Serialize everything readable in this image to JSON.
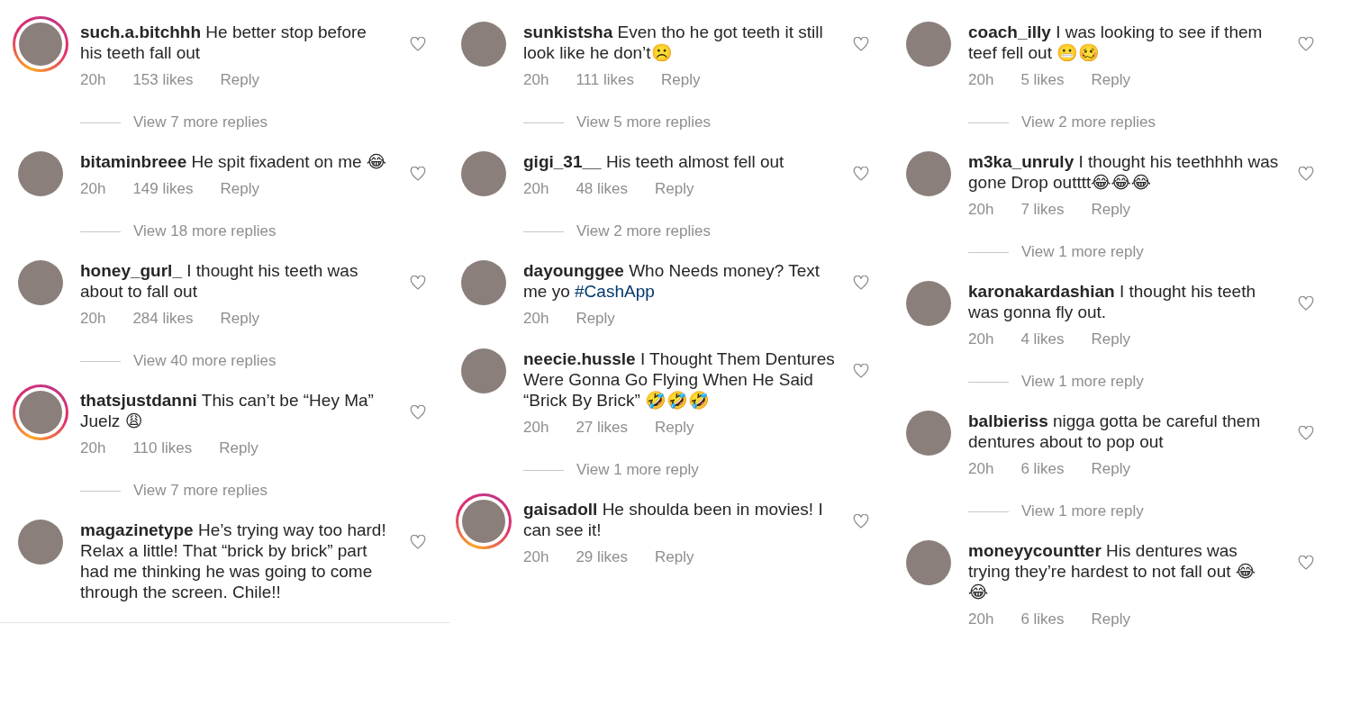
{
  "columns": [
    {
      "end_divider": true,
      "comments": [
        {
          "username": "such.a.bitchhh",
          "text": "He better stop before his teeth fall out",
          "story_ring": true,
          "time": "20h",
          "likes": "153 likes",
          "reply": "Reply",
          "view_replies": "View 7 more replies"
        },
        {
          "username": "bitaminbreee",
          "text": "He spit fixadent on me 😂",
          "story_ring": false,
          "time": "20h",
          "likes": "149 likes",
          "reply": "Reply",
          "view_replies": "View 18 more replies"
        },
        {
          "username": "honey_gurl_",
          "text": "I thought his teeth was about to fall out",
          "story_ring": false,
          "time": "20h",
          "likes": "284 likes",
          "reply": "Reply",
          "view_replies": "View 40 more replies"
        },
        {
          "username": "thatsjustdanni",
          "text": "This can’t be “Hey Ma” Juelz 😩",
          "story_ring": true,
          "time": "20h",
          "likes": "110 likes",
          "reply": "Reply",
          "view_replies": "View 7 more replies"
        },
        {
          "username": "magazinetype",
          "text": "He’s trying way too hard! Relax a little! That “brick by brick” part had me thinking he was going to come through the screen. Chile!!",
          "story_ring": false
        }
      ]
    },
    {
      "end_divider": false,
      "comments": [
        {
          "username": "sunkistsha",
          "text": "Even tho he got teeth it still look like he don’t☹️",
          "story_ring": false,
          "time": "20h",
          "likes": "111 likes",
          "reply": "Reply",
          "view_replies": "View 5 more replies"
        },
        {
          "username": "gigi_31__",
          "text": "His teeth almost fell out",
          "story_ring": false,
          "time": "20h",
          "likes": "48 likes",
          "reply": "Reply",
          "view_replies": "View 2 more replies"
        },
        {
          "username": "dayounggee",
          "text": "Who Needs money? Text me yo",
          "hashtag": "#CashApp",
          "story_ring": false,
          "time": "20h",
          "reply": "Reply"
        },
        {
          "username": "neecie.hussle",
          "text": "I Thought Them Dentures Were Gonna Go Flying When He Said “Brick By Brick” 🤣🤣🤣",
          "story_ring": false,
          "time": "20h",
          "likes": "27 likes",
          "reply": "Reply",
          "view_replies": "View 1 more reply"
        },
        {
          "username": "gaisadoll",
          "text": "He shoulda been in movies! I can see it!",
          "story_ring": true,
          "time": "20h",
          "likes": "29 likes",
          "reply": "Reply"
        }
      ]
    },
    {
      "end_divider": false,
      "comments": [
        {
          "username": "coach_illy",
          "text": "I was looking to see if them teef fell out 😬🥴",
          "story_ring": false,
          "time": "20h",
          "likes": "5 likes",
          "reply": "Reply",
          "view_replies": "View 2 more replies"
        },
        {
          "username": "m3ka_unruly",
          "text": "I thought his teethhhh was gone Drop outttt😂😂😂",
          "story_ring": false,
          "time": "20h",
          "likes": "7 likes",
          "reply": "Reply",
          "view_replies": "View 1 more reply"
        },
        {
          "username": "karonakardashian",
          "text": "I thought his teeth was gonna fly out.",
          "story_ring": false,
          "time": "20h",
          "likes": "4 likes",
          "reply": "Reply",
          "view_replies": "View 1 more reply"
        },
        {
          "username": "balbieriss",
          "text": "nigga gotta be careful them dentures about to pop out",
          "story_ring": false,
          "time": "20h",
          "likes": "6 likes",
          "reply": "Reply",
          "view_replies": "View 1 more reply"
        },
        {
          "username": "moneyycountter",
          "text": "His dentures was trying they’re hardest to not fall out 😂 😂",
          "story_ring": false,
          "time": "20h",
          "likes": "6 likes",
          "reply": "Reply"
        }
      ]
    }
  ]
}
